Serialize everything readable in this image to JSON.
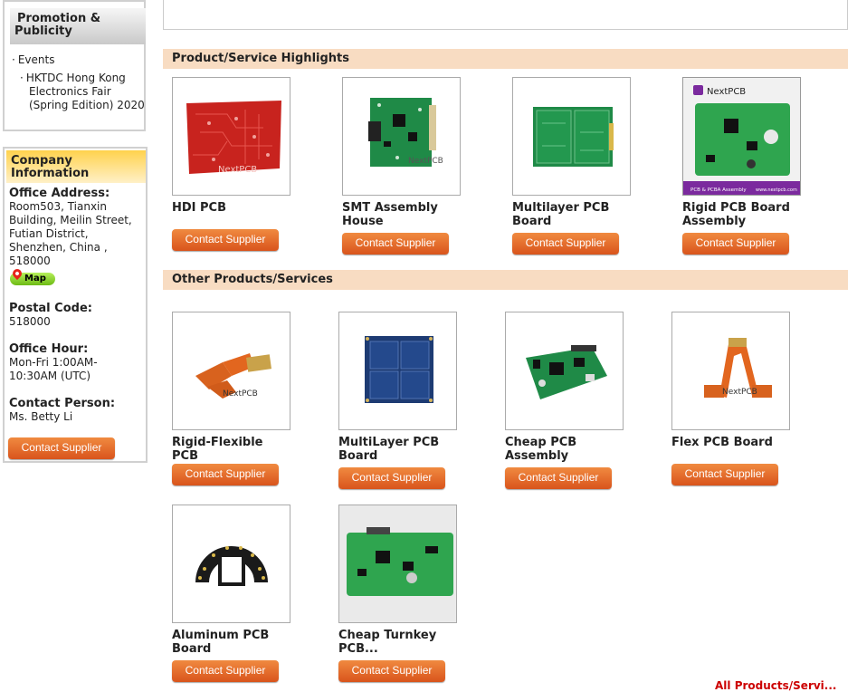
{
  "sidebar": {
    "promotion": {
      "title_line1": "Promotion &",
      "title_line2": "Publicity",
      "events_label": "Events",
      "event_item": "HKTDC Hong Kong Electronics Fair (Spring Edition) 2020"
    },
    "company": {
      "title_line1": "Company",
      "title_line2": "Information",
      "office_address_label": "Office Address:",
      "office_address": "Room503, Tianxin Building, Meilin Street, Futian District, Shenzhen, China , 518000",
      "map_label": "Map",
      "postal_code_label": "Postal Code:",
      "postal_code": "518000",
      "office_hour_label": "Office Hour:",
      "office_hour": "Mon-Fri 1:00AM-10:30AM (UTC)",
      "contact_person_label": "Contact Person:",
      "contact_person": "Ms. Betty Li",
      "contact_button": "Contact Supplier"
    }
  },
  "highlights": {
    "title": "Product/Service Highlights",
    "items": [
      {
        "name": "HDI PCB",
        "button": "Contact Supplier"
      },
      {
        "name": "SMT Assembly House",
        "button": "Contact Supplier"
      },
      {
        "name": "Multilayer PCB Board",
        "button": "Contact Supplier"
      },
      {
        "name": "Rigid PCB Board Assembly",
        "button": "Contact Supplier"
      }
    ]
  },
  "others": {
    "title": "Other Products/Services",
    "items": [
      {
        "name": "Rigid-Flexible PCB",
        "button": "Contact Supplier"
      },
      {
        "name": "MultiLayer PCB Board",
        "button": "Contact Supplier"
      },
      {
        "name": "Cheap PCB Assembly",
        "button": "Contact Supplier"
      },
      {
        "name": "Flex PCB Board",
        "button": "Contact Supplier"
      },
      {
        "name": "Aluminum PCB Board",
        "button": "Contact Supplier"
      },
      {
        "name": "Cheap Turnkey PCB...",
        "button": "Contact Supplier"
      }
    ]
  },
  "thumb_text": {
    "brand": "NextPCB",
    "banner": "PCB & PCBA Assembly",
    "url": "www.nextpcb.com"
  },
  "footer_link": "All Products/Servi...",
  "colors": {
    "section_bg": "#f8dcc2",
    "button_orange": "#e26a2c",
    "company_header": "#ffd24d",
    "pcb_red": "#c8231e",
    "pcb_green": "#1f8a47",
    "pcb_blue": "#1d3b73",
    "flex_orange": "#e2661f"
  }
}
